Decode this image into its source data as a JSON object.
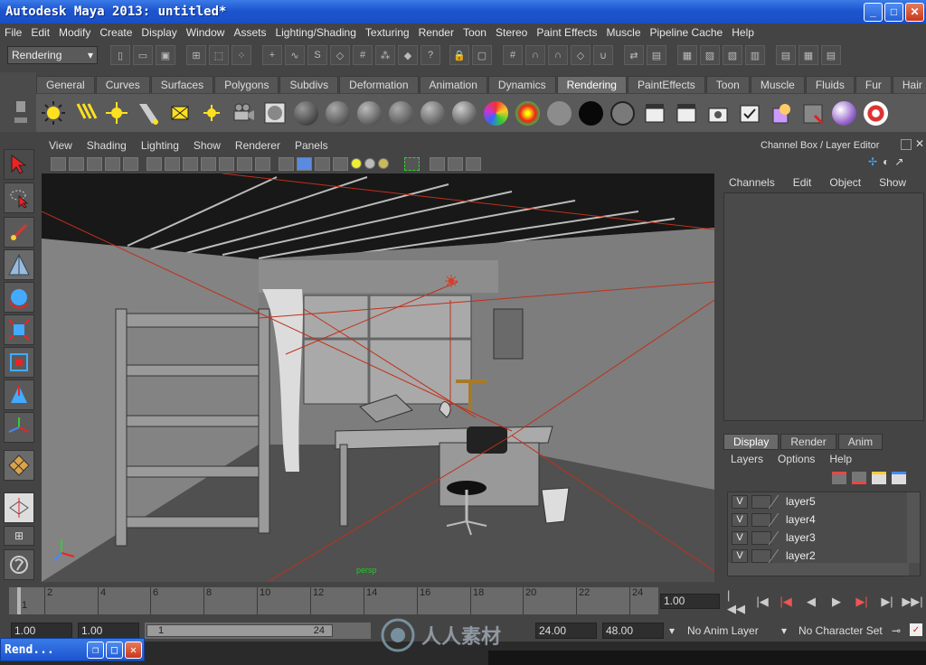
{
  "window": {
    "title": "Autodesk Maya 2013: untitled*"
  },
  "menubar": [
    "File",
    "Edit",
    "Modify",
    "Create",
    "Display",
    "Window",
    "Assets",
    "Lighting/Shading",
    "Texturing",
    "Render",
    "Toon",
    "Stereo",
    "Paint Effects",
    "Muscle",
    "Pipeline Cache",
    "Help"
  ],
  "status": {
    "mode": "Rendering"
  },
  "shelf": {
    "tabs": [
      "General",
      "Curves",
      "Surfaces",
      "Polygons",
      "Subdivs",
      "Deformation",
      "Animation",
      "Dynamics",
      "Rendering",
      "PaintEffects",
      "Toon",
      "Muscle",
      "Fluids",
      "Fur",
      "Hair"
    ],
    "active_tab": "Rendering"
  },
  "viewport": {
    "menu": [
      "View",
      "Shading",
      "Lighting",
      "Show",
      "Renderer",
      "Panels"
    ],
    "camera_label": "persp"
  },
  "channel_box": {
    "title": "Channel Box / Layer Editor",
    "menu": [
      "Channels",
      "Edit",
      "Object",
      "Show"
    ]
  },
  "layer_editor": {
    "tabs": [
      "Display",
      "Render",
      "Anim"
    ],
    "active_tab": "Display",
    "menu": [
      "Layers",
      "Options",
      "Help"
    ],
    "layers": [
      {
        "v": "V",
        "name": "layer5"
      },
      {
        "v": "V",
        "name": "layer4"
      },
      {
        "v": "V",
        "name": "layer3"
      },
      {
        "v": "V",
        "name": "layer2"
      }
    ]
  },
  "time_slider": {
    "ticks": [
      "2",
      "4",
      "6",
      "8",
      "10",
      "12",
      "14",
      "16",
      "18",
      "20",
      "22",
      "24"
    ],
    "start_label": "1",
    "current_frame": "1.00"
  },
  "range_slider": {
    "start_time": "1.00",
    "playback_start": "1.00",
    "range_start": "1",
    "range_end": "24",
    "playback_end": "24.00",
    "end_time": "48.00",
    "anim_layer": "No Anim Layer",
    "character_set": "No Character Set"
  },
  "taskbar": {
    "button_label": "Rend..."
  },
  "watermark": {
    "text": "人人素材"
  }
}
